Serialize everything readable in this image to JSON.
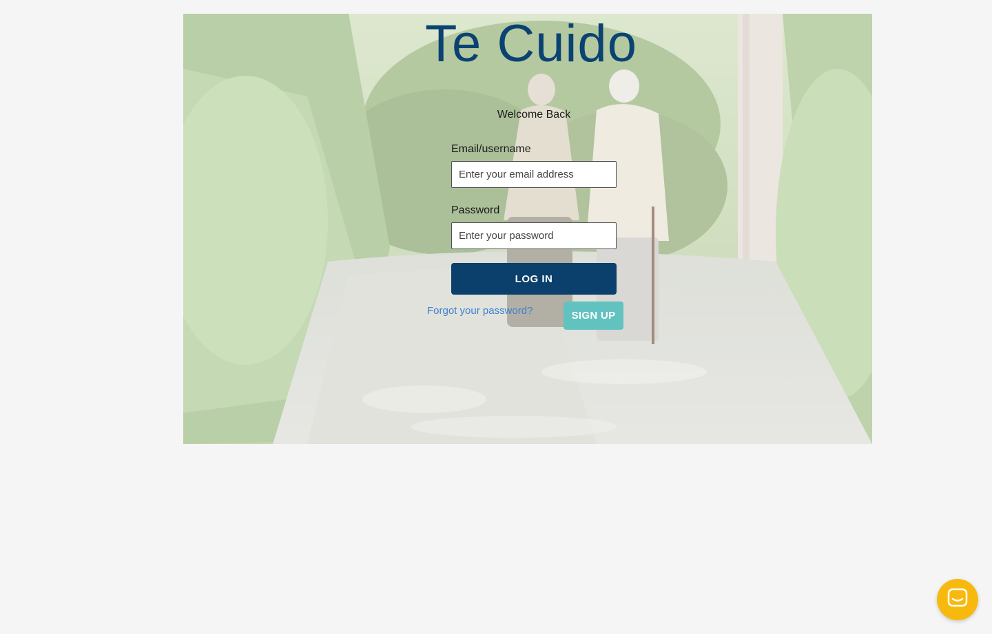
{
  "app": {
    "title": "Te Cuido"
  },
  "login": {
    "welcome": "Welcome Back",
    "email_label": "Email/username",
    "email_placeholder": "Enter your email address",
    "password_label": "Password",
    "password_placeholder": "Enter your password",
    "login_label": "LOG IN",
    "forgot_label": "Forgot your password?",
    "signup_label": "SIGN UP"
  },
  "icons": {
    "chat": "chat-bubble-icon",
    "background": "elderly-couple-garden-path-photo"
  },
  "colors": {
    "page_background": "#f5f5f5",
    "title": "#0a4272",
    "login_button": "#0b3f6c",
    "signup_button": "#62c2c0",
    "link": "#3d7fd1",
    "chat_launcher": "#f8b90f"
  }
}
